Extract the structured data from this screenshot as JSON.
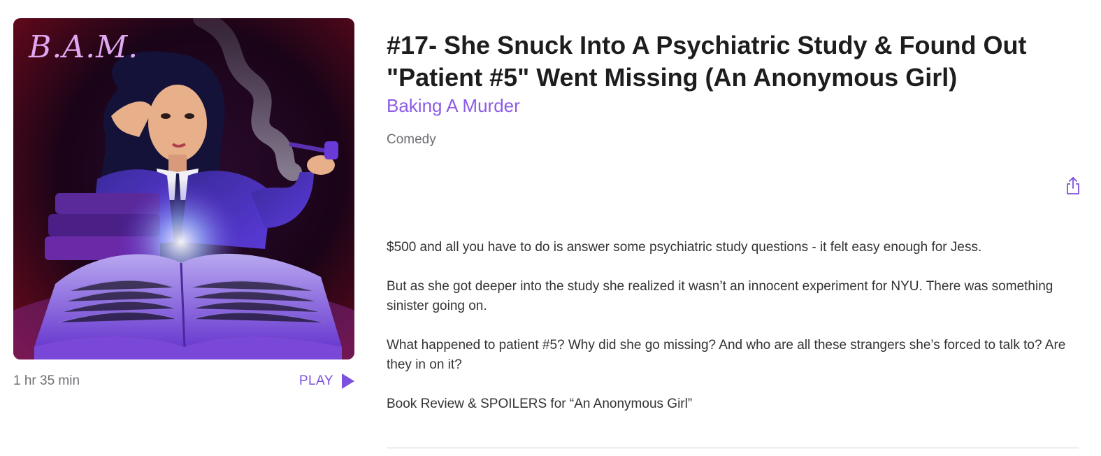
{
  "episode": {
    "title": "#17- She Snuck Into A Psychiatric Study & Found Out \"Patient #5\" Went Missing (An Anonymous Girl)",
    "show_name": "Baking A Murder",
    "genre": "Comedy",
    "duration": "1 hr 35 min",
    "play_label": "PLAY",
    "artwork_logo": "B.A.M.",
    "description": [
      "$500 and all you have to do is answer some psychiatric study questions - it felt easy enough for Jess.",
      "But as she got deeper into the study she realized it wasn’t an innocent experiment for NYU. There was something sinister going on.",
      "What happened to patient #5? Why did she go missing? And who are all these strangers she’s forced to talk to? Are they in on it?",
      "Book Review & SPOILERS for “An Anonymous Girl”"
    ]
  },
  "icons": {
    "play": "play-triangle-icon",
    "share": "share-icon"
  },
  "colors": {
    "accent": "#7d50de",
    "show_link": "#8c5ce8",
    "secondary_text": "#6e6e73",
    "divider": "#d2d2d7"
  }
}
